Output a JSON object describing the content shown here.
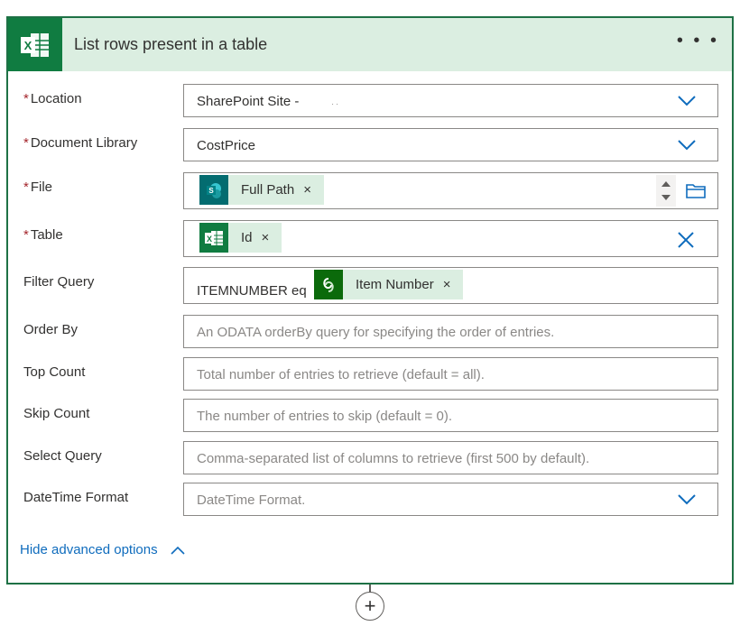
{
  "header": {
    "title": "List rows present in a table",
    "more_label": "• • •",
    "icon": "excel-icon"
  },
  "fields": {
    "location": {
      "label": "Location",
      "value": "SharePoint Site -",
      "value_suffix": ". ."
    },
    "document_library": {
      "label": "Document Library",
      "value": "CostPrice"
    },
    "file": {
      "label": "File",
      "token_label": "Full Path",
      "token_icon": "sharepoint-icon"
    },
    "table": {
      "label": "Table",
      "token_label": "Id",
      "token_icon": "excel-icon"
    },
    "filter_query": {
      "label": "Filter Query",
      "prefix": "ITEMNUMBER eq",
      "token_label": "Item Number",
      "token_icon": "dataverse-icon"
    },
    "order_by": {
      "label": "Order By",
      "placeholder": "An ODATA orderBy query for specifying the order of entries."
    },
    "top_count": {
      "label": "Top Count",
      "placeholder": "Total number of entries to retrieve (default = all)."
    },
    "skip_count": {
      "label": "Skip Count",
      "placeholder": "The number of entries to skip (default = 0)."
    },
    "select_query": {
      "label": "Select Query",
      "placeholder": "Comma-separated list of columns to retrieve (first 500 by default)."
    },
    "datetime_format": {
      "label": "DateTime Format",
      "placeholder": "DateTime Format."
    }
  },
  "required_mark": "*",
  "token_remove": "×",
  "advanced_toggle": {
    "label": "Hide advanced options"
  },
  "insert_step": {
    "label": "+"
  },
  "colors": {
    "brand": "#107c41",
    "token_bg": "#dbeee1",
    "link": "#0f6cbd",
    "chevron": "#0f6cbd",
    "sharepoint": "#036c70",
    "dataverse": "#0b6a0b"
  }
}
